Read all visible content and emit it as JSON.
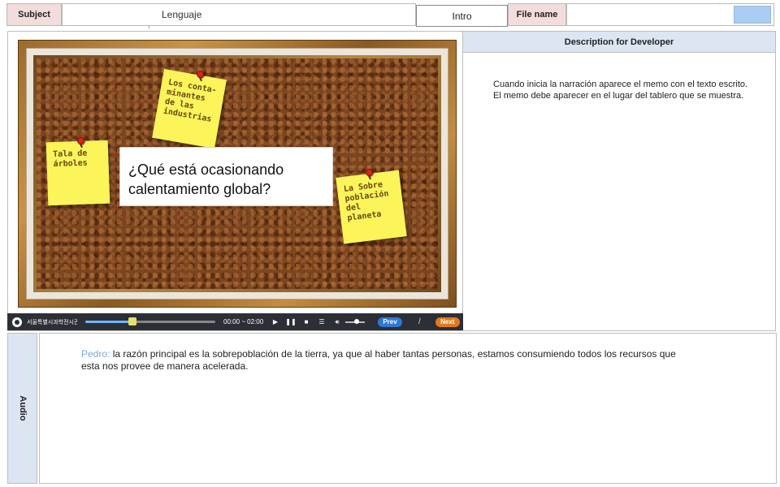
{
  "header": {
    "subject_label": "Subject",
    "subject_value": "Lenguaje",
    "screen_name": "Intro",
    "file_label": "File name",
    "file_value": "",
    "file_swatch_color": "#a9cdf3"
  },
  "screen": {
    "notes": [
      {
        "text": "Los conta-\nminantes\nde las\nindustrias"
      },
      {
        "text": "Tala de\nárboles"
      },
      {
        "text": "La Sobre\npoblación\ndel planeta"
      }
    ],
    "question": "¿Qué está ocasionando calentamiento global?"
  },
  "player": {
    "organization": "서울특별시과학전시관",
    "time": "00:00 ~ 02:00",
    "progress_fraction": 0.36,
    "prev_label": "Prev",
    "separator": "/",
    "next_label": "Next",
    "icons": [
      "play-icon",
      "pause-icon",
      "stop-icon",
      "menu-icon",
      "volume-icon"
    ]
  },
  "description": {
    "title": "Description for Developer",
    "text": "Cuando inicia la narración aparece el memo con el texto escrito.\nEl memo debe aparecer en el lugar del tablero que se muestra."
  },
  "audio": {
    "label": "Audio",
    "speaker": "Pedro:",
    "text": " la razón principal es la sobrepoblación de la tierra, ya que al haber tantas personas, estamos consumiendo todos los recursos que esta nos provee de manera  acelerada."
  }
}
